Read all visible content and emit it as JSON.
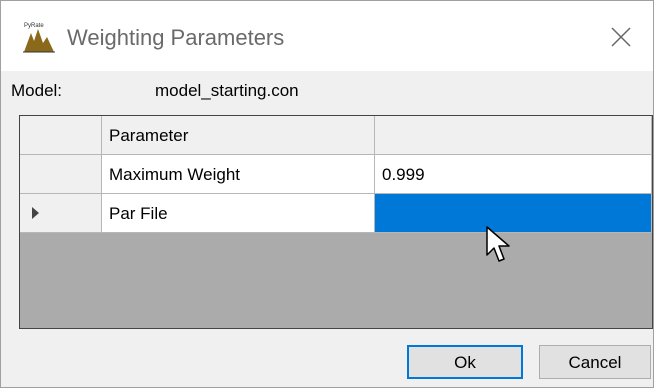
{
  "window": {
    "title": "Weighting Parameters",
    "icon": "pyrate-app-icon",
    "close_icon": "close-icon"
  },
  "model": {
    "label": "Model:",
    "value": "model_starting.con"
  },
  "grid": {
    "columns": [
      "Parameter",
      ""
    ],
    "rows": [
      {
        "parameter": "Maximum Weight",
        "value": "0.999",
        "selected": false
      },
      {
        "parameter": "Par File",
        "value": "",
        "selected": true
      }
    ],
    "selection_color": "#0078d7"
  },
  "buttons": {
    "ok_label": "Ok",
    "cancel_label": "Cancel"
  },
  "colors": {
    "accent": "#0078d7",
    "grid_empty_bg": "#ababab",
    "chrome_bg": "#f0f0f0"
  }
}
